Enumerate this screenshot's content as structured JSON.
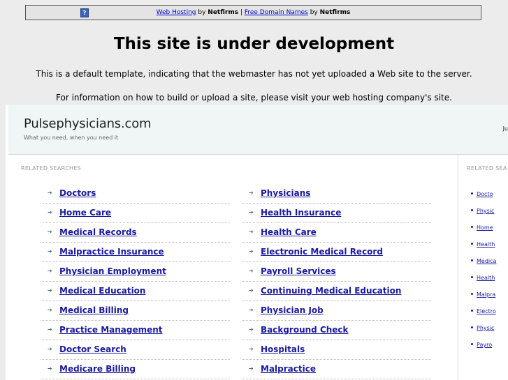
{
  "topbar": {
    "icon": "question-icon",
    "web_hosting": "Web Hosting",
    "by1": " by ",
    "netfirms1": "Netfirms",
    "sep": " | ",
    "free_domain": "Free Domain Names",
    "by2": " by ",
    "netfirms2": "Netfirms"
  },
  "heading": "This site is under development",
  "message1": "This is a default template, indicating that the webmaster has not yet uploaded a Web site to the server.",
  "message2": "For information on how to build or upload a site, please visit your web hosting company's site.",
  "site": {
    "title": "Pulsephysicians.com",
    "tagline": "What you need, when you need it",
    "right_text": "Ju"
  },
  "related_label": "RELATED SEARCHES",
  "left_links": [
    "Doctors",
    "Home Care",
    "Medical Records",
    "Malpractice Insurance",
    "Physician Employment",
    "Medical Education",
    "Medical Billing",
    "Practice Management",
    "Doctor Search",
    "Medicare Billing"
  ],
  "right_links": [
    "Physicians",
    "Health Insurance",
    "Health Care",
    "Electronic Medical Record",
    "Payroll Services",
    "Continuing Medical Education",
    "Physician Job",
    "Background Check",
    "Hospitals",
    "Malpractice"
  ],
  "side_label": "RELATED SEA",
  "side_links": [
    "Docto",
    "Physic",
    "Home",
    "Health",
    "Medica",
    "Health",
    "Malpra",
    "Electro",
    "Physic",
    "Payro"
  ],
  "colors": {
    "link": "#1a1a9e",
    "header_bg": "#f0f5f6",
    "page_bg": "#ececec"
  }
}
